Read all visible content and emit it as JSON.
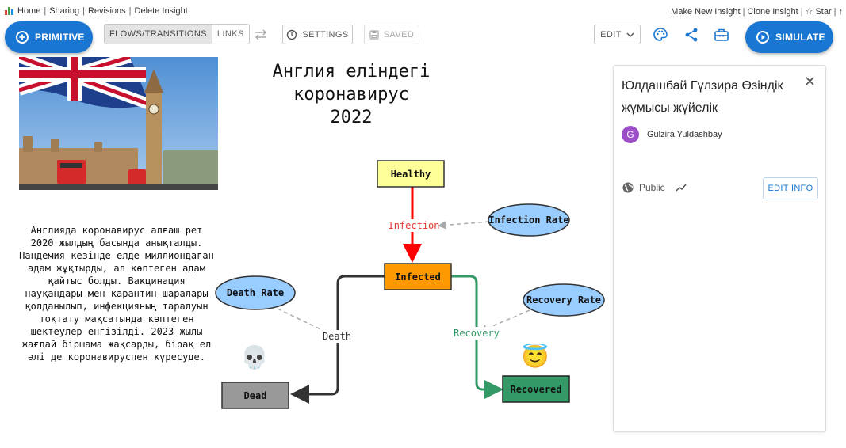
{
  "topbar": {
    "home": "Home",
    "sharing": "Sharing",
    "revisions": "Revisions",
    "delete": "Delete Insight",
    "make_new": "Make New Insight",
    "clone": "Clone Insight",
    "star": "☆ Star",
    "sep": "|",
    "tail": "↑"
  },
  "toolbar": {
    "primitive": "PRIMITIVE",
    "flows": "FLOWS/TRANSITIONS",
    "links": "LINKS",
    "settings": "SETTINGS",
    "saved": "SAVED",
    "edit": "EDIT",
    "simulate": "SIMULATE"
  },
  "canvas": {
    "title_lines": [
      "Англия еліндегі",
      "коронавирус",
      "2022"
    ],
    "description": "Англияда коронавирус алғаш рет 2020 жылдың басында анықталды. Пандемия кезінде елде миллиондаған адам жұқтырды, ал көптеген адам қайтыс болды. Вакцинация науқандары мен карантин шаралары қолданылып, инфекцияның таралуын тоқтату мақсатында көптеген шектеулер енгізілді. 2023 жылы жағдай біршама жақсарды, бірақ ел әлі де коронавируспен күресуде.",
    "nodes": {
      "healthy": "Healthy",
      "infected": "Infected",
      "dead": "Dead",
      "recovered": "Recovered"
    },
    "variables": {
      "infection_rate": "Infection Rate",
      "death_rate": "Death Rate",
      "recovery_rate": "Recovery Rate"
    },
    "flows": {
      "infection": "Infection",
      "death": "Death",
      "recovery": "Recovery"
    },
    "emoji": {
      "skull": "💀",
      "angel": "😇"
    }
  },
  "panel": {
    "title": "Юлдашбай Гүлзира Өзіндік жұмысы жүйелік",
    "avatar_letter": "G",
    "author": "Gulzira Yuldashbay",
    "visibility": "Public",
    "edit_info": "EDIT INFO"
  },
  "colors": {
    "primary": "#1976d2",
    "healthy": "#ffff99",
    "infected": "#ff9900",
    "dead": "#999999",
    "recovered": "#339966",
    "variable": "#99ccff",
    "infection_flow": "#ff0000",
    "recovery_flow": "#339966",
    "death_flow": "#333333"
  }
}
